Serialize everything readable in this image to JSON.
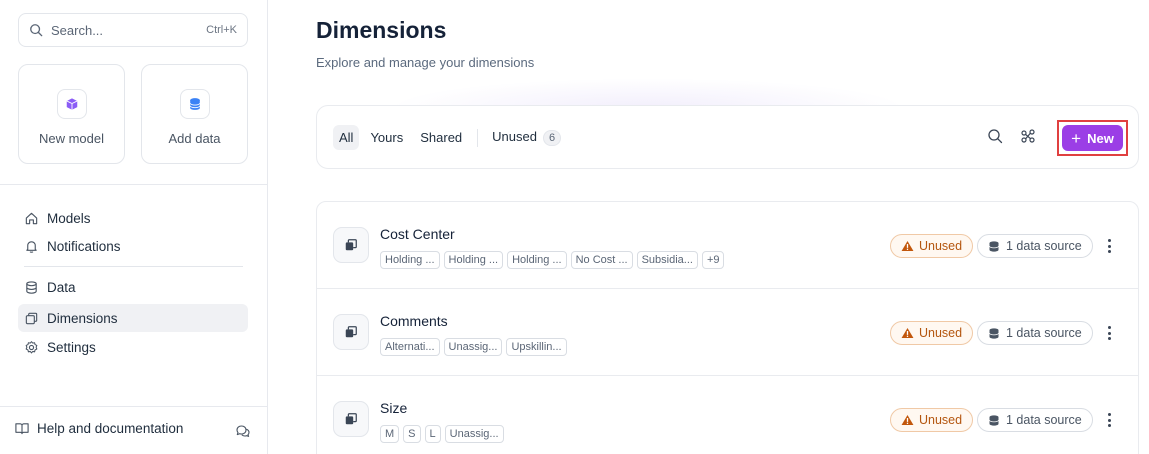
{
  "sidebar": {
    "search": {
      "label": "Search...",
      "shortcut": "Ctrl+K"
    },
    "quick_actions": [
      {
        "label": "New model",
        "icon": "cube-icon",
        "color": "#8b5cf6"
      },
      {
        "label": "Add data",
        "icon": "database-icon",
        "color": "#3b82f6"
      }
    ],
    "nav": [
      {
        "label": "Models",
        "icon": "home-icon"
      },
      {
        "label": "Notifications",
        "icon": "bell-icon"
      },
      {
        "label": "Data",
        "icon": "database-icon"
      },
      {
        "label": "Dimensions",
        "icon": "copy-icon",
        "active": true
      },
      {
        "label": "Settings",
        "icon": "gear-icon"
      }
    ],
    "help": {
      "label": "Help and documentation"
    }
  },
  "page": {
    "title": "Dimensions",
    "subtitle": "Explore and manage your dimensions"
  },
  "toolbar": {
    "filters": [
      {
        "label": "All",
        "active": true
      },
      {
        "label": "Yours"
      },
      {
        "label": "Shared"
      }
    ],
    "unused_filter": {
      "label": "Unused",
      "count": "6"
    },
    "new_label": "New",
    "accent": "#9b3ee6"
  },
  "rows": [
    {
      "name": "Cost Center",
      "tags": [
        "Holding ...",
        "Holding ...",
        "Holding ...",
        "No Cost ...",
        "Subsidia...",
        "+9"
      ],
      "status": "Unused",
      "source": "1 data source"
    },
    {
      "name": "Comments",
      "tags": [
        "Alternati...",
        "Unassig...",
        "Upskillin..."
      ],
      "status": "Unused",
      "source": "1 data source"
    },
    {
      "name": "Size",
      "tags": [
        "M",
        "S",
        "L",
        "Unassig..."
      ],
      "status": "Unused",
      "source": "1 data source"
    }
  ]
}
